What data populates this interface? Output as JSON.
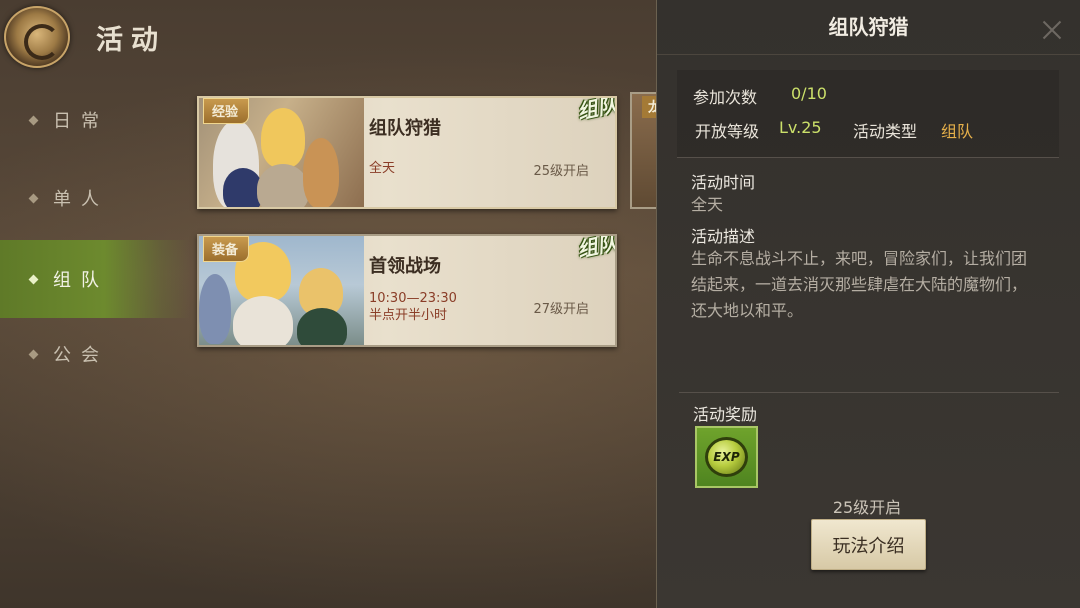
{
  "header": {
    "title": "活动"
  },
  "nav": {
    "items": [
      {
        "label": "日常",
        "active": false
      },
      {
        "label": "单人",
        "active": false
      },
      {
        "label": "组队",
        "active": true
      },
      {
        "label": "公会",
        "active": false
      }
    ]
  },
  "cards": [
    {
      "tag": "经验",
      "name": "组队狩猎",
      "time_line1": "全天",
      "time_line2": "",
      "level": "25级开启",
      "stamp": "组队"
    },
    {
      "tag": "装备",
      "name": "首领战场",
      "time_line1": "10:30—23:30",
      "time_line2": "半点开半小时",
      "level": "27级开启",
      "stamp": "组队"
    }
  ],
  "peek_card": {
    "tag": "龙"
  },
  "detail": {
    "title": "组队狩猎",
    "attempts_label": "参加次数",
    "attempts_value": "0/10",
    "level_label": "开放等级",
    "level_value": "Lv.25",
    "type_label": "活动类型",
    "type_value": "组队",
    "time_label": "活动时间",
    "time_value": "全天",
    "desc_label": "活动描述",
    "desc_text": "生命不息战斗不止，来吧，冒险家们，让我们团结起来，一道去消灭那些肆虐在大陆的魔物们，还大地以和平。",
    "reward_label": "活动奖励",
    "reward_icon": "exp-icon",
    "reward_text": "EXP",
    "unlock_text": "25级开启",
    "intro_button": "玩法介绍"
  },
  "colors": {
    "nav_active": "#6d8a2e",
    "level_value": "#cbe06a",
    "type_value": "#e6b04a",
    "card_time": "#8a3d27"
  }
}
